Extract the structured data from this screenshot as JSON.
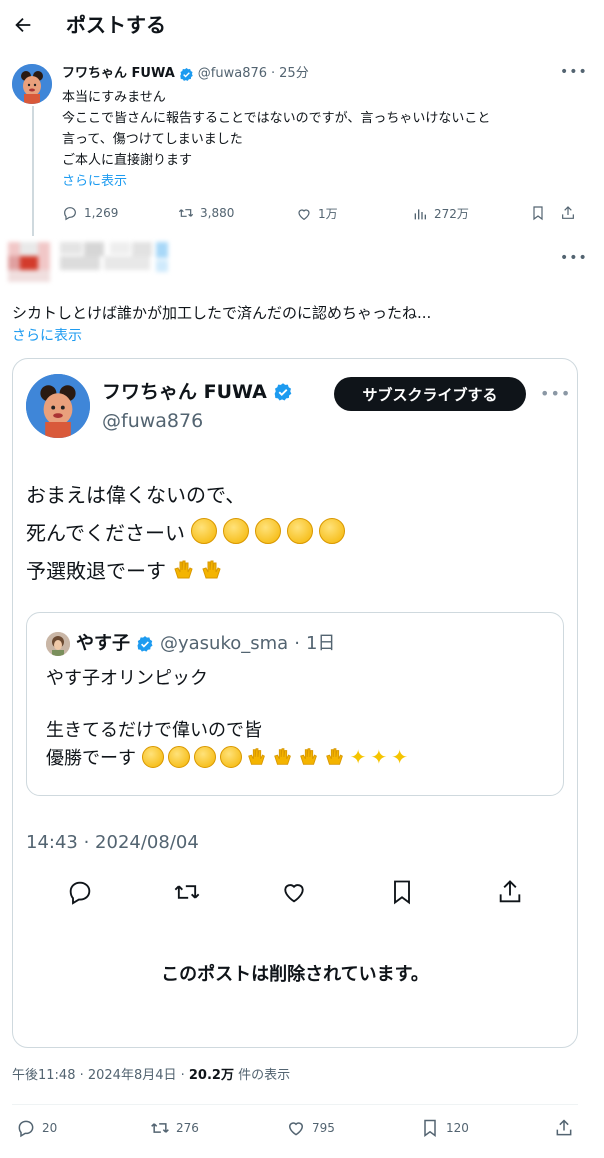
{
  "header": {
    "title": "ポストする"
  },
  "post1": {
    "name": "フワちゃん FUWA",
    "handle": "@fuwa876",
    "sep": "·",
    "time": "25分",
    "lines": [
      "本当にすみません",
      "今ここで皆さんに報告することではないのですが、言っちゃいけないこと",
      "言って、傷つけてしまいました",
      "ご本人に直接謝ります"
    ],
    "show_more": "さらに表示",
    "replies": "1,269",
    "reposts": "3,880",
    "likes": "1万",
    "views": "272万"
  },
  "post2": {
    "text": "シカトしとけば誰かが加工したで済んだのに認めちゃったね...",
    "show_more": "さらに表示"
  },
  "embed": {
    "name": "フワちゃん FUWA",
    "handle": "@fuwa876",
    "subscribe": "サブスクライブする",
    "line1": "おまえは偉くないので、",
    "line2": "死んでくださーい",
    "line3": "予選敗退でーす",
    "quote": {
      "name": "やす子",
      "handle": "@yasuko_sma",
      "sep": "·",
      "time": "1日",
      "line1": "やす子オリンピック",
      "line2": "生きてるだけで偉いので皆",
      "line3": "優勝でーす"
    },
    "timestamp": "14:43 · 2024/08/04",
    "deleted_notice": "このポストは削除されています。"
  },
  "meta": {
    "time": "午後11:48 · 2024年8月4日 · ",
    "views_count": "20.2万",
    "views_label": " 件の表示"
  },
  "bottom_actions": {
    "replies": "20",
    "reposts": "276",
    "likes": "795",
    "bookmarks": "120"
  },
  "colors": {
    "accent": "#1d9bf0",
    "text": "#0f1419",
    "muted": "#536471",
    "border": "#cfd9de"
  }
}
